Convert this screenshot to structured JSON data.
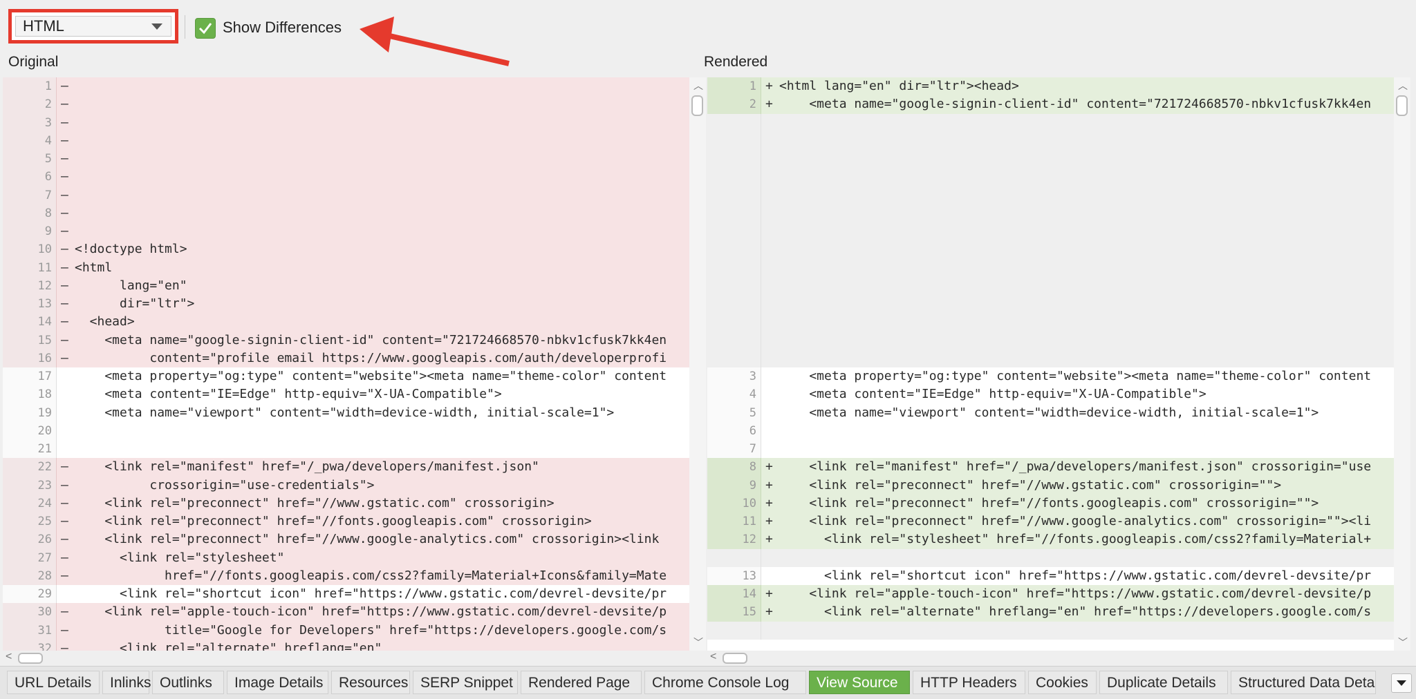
{
  "toolbar": {
    "view_select": "HTML",
    "show_differences_label": "Show Differences",
    "show_differences_checked": true
  },
  "panels": {
    "left_title": "Original",
    "right_title": "Rendered"
  },
  "colors": {
    "accent_green": "#6bb14b",
    "annotation_red": "#e53a2d",
    "deleted_bg": "#f7e3e4",
    "added_bg": "#e5efdc"
  },
  "original_lines": [
    {
      "n": "1",
      "s": "–",
      "t": "",
      "k": "del"
    },
    {
      "n": "2",
      "s": "–",
      "t": "",
      "k": "del"
    },
    {
      "n": "3",
      "s": "–",
      "t": "",
      "k": "del"
    },
    {
      "n": "4",
      "s": "–",
      "t": "",
      "k": "del"
    },
    {
      "n": "5",
      "s": "–",
      "t": "",
      "k": "del"
    },
    {
      "n": "6",
      "s": "–",
      "t": "",
      "k": "del"
    },
    {
      "n": "7",
      "s": "–",
      "t": "",
      "k": "del"
    },
    {
      "n": "8",
      "s": "–",
      "t": "",
      "k": "del"
    },
    {
      "n": "9",
      "s": "–",
      "t": "",
      "k": "del"
    },
    {
      "n": "10",
      "s": "–",
      "t": "<!doctype html>",
      "k": "del"
    },
    {
      "n": "11",
      "s": "–",
      "t": "<html",
      "k": "del"
    },
    {
      "n": "12",
      "s": "–",
      "t": "      lang=\"en\"",
      "k": "del"
    },
    {
      "n": "13",
      "s": "–",
      "t": "      dir=\"ltr\">",
      "k": "del"
    },
    {
      "n": "14",
      "s": "–",
      "t": "  <head>",
      "k": "del"
    },
    {
      "n": "15",
      "s": "–",
      "t": "    <meta name=\"google-signin-client-id\" content=\"721724668570-nbkv1cfusk7kk4en",
      "k": "del"
    },
    {
      "n": "16",
      "s": "–",
      "t": "          content=\"profile email https://www.googleapis.com/auth/developerprofi",
      "k": "del"
    },
    {
      "n": "17",
      "s": "",
      "t": "    <meta property=\"og:type\" content=\"website\"><meta name=\"theme-color\" content",
      "k": "ctx"
    },
    {
      "n": "18",
      "s": "",
      "t": "    <meta content=\"IE=Edge\" http-equiv=\"X-UA-Compatible\">",
      "k": "ctx"
    },
    {
      "n": "19",
      "s": "",
      "t": "    <meta name=\"viewport\" content=\"width=device-width, initial-scale=1\">",
      "k": "ctx"
    },
    {
      "n": "20",
      "s": "",
      "t": "",
      "k": "ctx"
    },
    {
      "n": "21",
      "s": "",
      "t": "",
      "k": "ctx"
    },
    {
      "n": "22",
      "s": "–",
      "t": "    <link rel=\"manifest\" href=\"/_pwa/developers/manifest.json\"",
      "k": "del"
    },
    {
      "n": "23",
      "s": "–",
      "t": "          crossorigin=\"use-credentials\">",
      "k": "del"
    },
    {
      "n": "24",
      "s": "–",
      "t": "    <link rel=\"preconnect\" href=\"//www.gstatic.com\" crossorigin>",
      "k": "del"
    },
    {
      "n": "25",
      "s": "–",
      "t": "    <link rel=\"preconnect\" href=\"//fonts.googleapis.com\" crossorigin>",
      "k": "del"
    },
    {
      "n": "26",
      "s": "–",
      "t": "    <link rel=\"preconnect\" href=\"//www.google-analytics.com\" crossorigin><link",
      "k": "del"
    },
    {
      "n": "27",
      "s": "–",
      "t": "      <link rel=\"stylesheet\"",
      "k": "del"
    },
    {
      "n": "28",
      "s": "–",
      "t": "            href=\"//fonts.googleapis.com/css2?family=Material+Icons&family=Mate",
      "k": "del"
    },
    {
      "n": "29",
      "s": "",
      "t": "      <link rel=\"shortcut icon\" href=\"https://www.gstatic.com/devrel-devsite/pr",
      "k": "ctx"
    },
    {
      "n": "30",
      "s": "–",
      "t": "    <link rel=\"apple-touch-icon\" href=\"https://www.gstatic.com/devrel-devsite/p",
      "k": "del"
    },
    {
      "n": "31",
      "s": "–",
      "t": "            title=\"Google for Developers\" href=\"https://developers.google.com/s",
      "k": "del"
    },
    {
      "n": "32",
      "s": "–",
      "t": "      <link rel=\"alternate\" hreflang=\"en\"",
      "k": "del"
    }
  ],
  "rendered_lines": [
    {
      "n": "1",
      "s": "+",
      "t": "<html lang=\"en\" dir=\"ltr\"><head>",
      "k": "add"
    },
    {
      "n": "2",
      "s": "+",
      "t": "    <meta name=\"google-signin-client-id\" content=\"721724668570-nbkv1cfusk7kk4en",
      "k": "add"
    },
    {
      "n": "",
      "s": "",
      "t": "",
      "k": "blank"
    },
    {
      "n": "",
      "s": "",
      "t": "",
      "k": "blank"
    },
    {
      "n": "",
      "s": "",
      "t": "",
      "k": "blank"
    },
    {
      "n": "",
      "s": "",
      "t": "",
      "k": "blank"
    },
    {
      "n": "",
      "s": "",
      "t": "",
      "k": "blank"
    },
    {
      "n": "",
      "s": "",
      "t": "",
      "k": "blank"
    },
    {
      "n": "",
      "s": "",
      "t": "",
      "k": "blank"
    },
    {
      "n": "",
      "s": "",
      "t": "",
      "k": "blank"
    },
    {
      "n": "",
      "s": "",
      "t": "",
      "k": "blank"
    },
    {
      "n": "",
      "s": "",
      "t": "",
      "k": "blank"
    },
    {
      "n": "",
      "s": "",
      "t": "",
      "k": "blank"
    },
    {
      "n": "",
      "s": "",
      "t": "",
      "k": "blank"
    },
    {
      "n": "",
      "s": "",
      "t": "",
      "k": "blank"
    },
    {
      "n": "",
      "s": "",
      "t": "",
      "k": "blank"
    },
    {
      "n": "3",
      "s": "",
      "t": "    <meta property=\"og:type\" content=\"website\"><meta name=\"theme-color\" content",
      "k": "ctx"
    },
    {
      "n": "4",
      "s": "",
      "t": "    <meta content=\"IE=Edge\" http-equiv=\"X-UA-Compatible\">",
      "k": "ctx"
    },
    {
      "n": "5",
      "s": "",
      "t": "    <meta name=\"viewport\" content=\"width=device-width, initial-scale=1\">",
      "k": "ctx"
    },
    {
      "n": "6",
      "s": "",
      "t": "",
      "k": "ctx"
    },
    {
      "n": "7",
      "s": "",
      "t": "",
      "k": "ctx"
    },
    {
      "n": "8",
      "s": "+",
      "t": "    <link rel=\"manifest\" href=\"/_pwa/developers/manifest.json\" crossorigin=\"use",
      "k": "add"
    },
    {
      "n": "9",
      "s": "+",
      "t": "    <link rel=\"preconnect\" href=\"//www.gstatic.com\" crossorigin=\"\">",
      "k": "add"
    },
    {
      "n": "10",
      "s": "+",
      "t": "    <link rel=\"preconnect\" href=\"//fonts.googleapis.com\" crossorigin=\"\">",
      "k": "add"
    },
    {
      "n": "11",
      "s": "+",
      "t": "    <link rel=\"preconnect\" href=\"//www.google-analytics.com\" crossorigin=\"\"><li",
      "k": "add"
    },
    {
      "n": "12",
      "s": "+",
      "t": "      <link rel=\"stylesheet\" href=\"//fonts.googleapis.com/css2?family=Material+",
      "k": "add"
    },
    {
      "n": "",
      "s": "",
      "t": "",
      "k": "blank"
    },
    {
      "n": "13",
      "s": "",
      "t": "      <link rel=\"shortcut icon\" href=\"https://www.gstatic.com/devrel-devsite/pr",
      "k": "ctx"
    },
    {
      "n": "14",
      "s": "+",
      "t": "    <link rel=\"apple-touch-icon\" href=\"https://www.gstatic.com/devrel-devsite/p",
      "k": "add"
    },
    {
      "n": "15",
      "s": "+",
      "t": "      <link rel=\"alternate\" hreflang=\"en\" href=\"https://developers.google.com/s",
      "k": "add"
    },
    {
      "n": "",
      "s": "",
      "t": "",
      "k": "blank"
    }
  ],
  "tabs": [
    {
      "label": "URL Details",
      "active": false
    },
    {
      "label": "Inlinks",
      "active": false
    },
    {
      "label": "Outlinks",
      "active": false
    },
    {
      "label": "Image Details",
      "active": false
    },
    {
      "label": "Resources",
      "active": false
    },
    {
      "label": "SERP Snippet",
      "active": false
    },
    {
      "label": "Rendered Page",
      "active": false
    },
    {
      "label": "Chrome Console Log",
      "active": false
    },
    {
      "label": "View Source",
      "active": true
    },
    {
      "label": "HTTP Headers",
      "active": false
    },
    {
      "label": "Cookies",
      "active": false
    },
    {
      "label": "Duplicate Details",
      "active": false
    },
    {
      "label": "Structured Data Deta",
      "active": false
    }
  ]
}
